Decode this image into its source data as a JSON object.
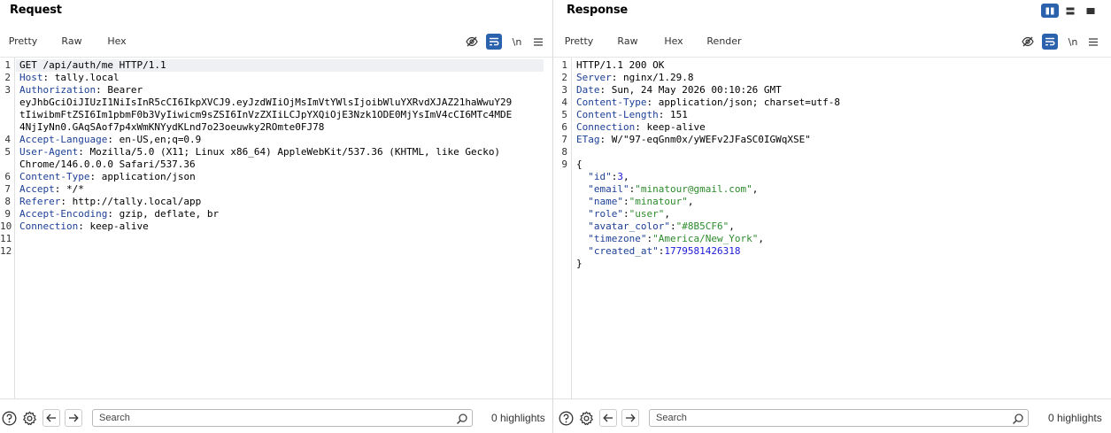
{
  "request": {
    "title": "Request",
    "tabs": [
      {
        "label": "Pretty",
        "active": true
      },
      {
        "label": "Raw",
        "active": false
      },
      {
        "label": "Hex",
        "active": false
      }
    ],
    "tools": {
      "newline_label": "\\n"
    },
    "lines": [
      {
        "n": "1",
        "parts": [
          [
            "hv",
            "GET /api/auth/me HTTP/1.1"
          ]
        ]
      },
      {
        "n": "2",
        "parts": [
          [
            "hk",
            "Host"
          ],
          [
            "hv",
            ": tally.local"
          ]
        ]
      },
      {
        "n": "3",
        "parts": [
          [
            "hk",
            "Authorization"
          ],
          [
            "hv",
            ": Bearer"
          ]
        ]
      },
      {
        "n": "",
        "parts": [
          [
            "hv",
            "eyJhbGciOiJIUzI1NiIsInR5cCI6IkpXVCJ9.eyJzdWIiOjMsImVtYWlsIjoibWluYXRvdXJAZ21haWwuY29"
          ]
        ]
      },
      {
        "n": "",
        "parts": [
          [
            "hv",
            "tIiwibmFtZSI6Im1pbmF0b3VyIiwicm9sZSI6InVzZXIiLCJpYXQiOjE3Nzk1ODE0MjYsImV4cCI6MTc4MDE"
          ]
        ]
      },
      {
        "n": "",
        "parts": [
          [
            "hv",
            "4NjIyNn0.GAqSAof7p4xWmKNYydKLnd7o23oeuwky2ROmte0FJ78"
          ]
        ]
      },
      {
        "n": "4",
        "parts": [
          [
            "hk",
            "Accept-Language"
          ],
          [
            "hv",
            ": en-US,en;q=0.9"
          ]
        ]
      },
      {
        "n": "5",
        "parts": [
          [
            "hk",
            "User-Agent"
          ],
          [
            "hv",
            ": Mozilla/5.0 (X11; Linux x86_64) AppleWebKit/537.36 (KHTML, like Gecko)"
          ]
        ]
      },
      {
        "n": "",
        "parts": [
          [
            "hv",
            "Chrome/146.0.0.0 Safari/537.36"
          ]
        ]
      },
      {
        "n": "6",
        "parts": [
          [
            "hk",
            "Content-Type"
          ],
          [
            "hv",
            ": application/json"
          ]
        ]
      },
      {
        "n": "7",
        "parts": [
          [
            "hk",
            "Accept"
          ],
          [
            "hv",
            ": */*"
          ]
        ]
      },
      {
        "n": "8",
        "parts": [
          [
            "hk",
            "Referer"
          ],
          [
            "hv",
            ": http://tally.local/app"
          ]
        ]
      },
      {
        "n": "9",
        "parts": [
          [
            "hk",
            "Accept-Encoding"
          ],
          [
            "hv",
            ": gzip, deflate, br"
          ]
        ]
      },
      {
        "n": "10",
        "parts": [
          [
            "hk",
            "Connection"
          ],
          [
            "hv",
            ": keep-alive"
          ]
        ]
      },
      {
        "n": "11",
        "parts": []
      },
      {
        "n": "12",
        "parts": []
      }
    ],
    "footer": {
      "search_placeholder": "Search",
      "highlights": "0 highlights"
    }
  },
  "response": {
    "title": "Response",
    "tabs": [
      {
        "label": "Pretty",
        "active": true
      },
      {
        "label": "Raw",
        "active": false
      },
      {
        "label": "Hex",
        "active": false
      },
      {
        "label": "Render",
        "active": false
      }
    ],
    "tools": {
      "newline_label": "\\n"
    },
    "lines": [
      {
        "n": "1",
        "parts": [
          [
            "hv",
            "HTTP/1.1 200 OK"
          ]
        ]
      },
      {
        "n": "2",
        "parts": [
          [
            "hk",
            "Server"
          ],
          [
            "hv",
            ": nginx/1.29.8"
          ]
        ]
      },
      {
        "n": "3",
        "parts": [
          [
            "hk",
            "Date"
          ],
          [
            "hv",
            ": Sun, 24 May 2026 00:10:26 GMT"
          ]
        ]
      },
      {
        "n": "4",
        "parts": [
          [
            "hk",
            "Content-Type"
          ],
          [
            "hv",
            ": application/json; charset=utf-8"
          ]
        ]
      },
      {
        "n": "5",
        "parts": [
          [
            "hk",
            "Content-Length"
          ],
          [
            "hv",
            ": 151"
          ]
        ]
      },
      {
        "n": "6",
        "parts": [
          [
            "hk",
            "Connection"
          ],
          [
            "hv",
            ": keep-alive"
          ]
        ]
      },
      {
        "n": "7",
        "parts": [
          [
            "hk",
            "ETag"
          ],
          [
            "hv",
            ": W/\"97-eqGnm0x/yWEFv2JFaSC0IGWqXSE\""
          ]
        ]
      },
      {
        "n": "8",
        "parts": []
      },
      {
        "n": "9",
        "parts": [
          [
            "jp",
            "{"
          ]
        ]
      },
      {
        "n": "",
        "parts": [
          [
            "jp",
            "  "
          ],
          [
            "jk",
            "\"id\""
          ],
          [
            "jp",
            ":"
          ],
          [
            "jn",
            "3"
          ],
          [
            "jp",
            ","
          ]
        ]
      },
      {
        "n": "",
        "parts": [
          [
            "jp",
            "  "
          ],
          [
            "jk",
            "\"email\""
          ],
          [
            "jp",
            ":"
          ],
          [
            "js",
            "\"minatour@gmail.com\""
          ],
          [
            "jp",
            ","
          ]
        ]
      },
      {
        "n": "",
        "parts": [
          [
            "jp",
            "  "
          ],
          [
            "jk",
            "\"name\""
          ],
          [
            "jp",
            ":"
          ],
          [
            "js",
            "\"minatour\""
          ],
          [
            "jp",
            ","
          ]
        ]
      },
      {
        "n": "",
        "parts": [
          [
            "jp",
            "  "
          ],
          [
            "jk",
            "\"role\""
          ],
          [
            "jp",
            ":"
          ],
          [
            "js",
            "\"user\""
          ],
          [
            "jp",
            ","
          ]
        ]
      },
      {
        "n": "",
        "parts": [
          [
            "jp",
            "  "
          ],
          [
            "jk",
            "\"avatar_color\""
          ],
          [
            "jp",
            ":"
          ],
          [
            "js",
            "\"#8B5CF6\""
          ],
          [
            "jp",
            ","
          ]
        ]
      },
      {
        "n": "",
        "parts": [
          [
            "jp",
            "  "
          ],
          [
            "jk",
            "\"timezone\""
          ],
          [
            "jp",
            ":"
          ],
          [
            "js",
            "\"America/New_York\""
          ],
          [
            "jp",
            ","
          ]
        ]
      },
      {
        "n": "",
        "parts": [
          [
            "jp",
            "  "
          ],
          [
            "jk",
            "\"created_at\""
          ],
          [
            "jp",
            ":"
          ],
          [
            "jn",
            "1779581426318"
          ]
        ]
      },
      {
        "n": "",
        "parts": [
          [
            "jp",
            "}"
          ]
        ]
      }
    ],
    "footer": {
      "search_placeholder": "Search",
      "highlights": "0 highlights"
    }
  },
  "colors": {
    "accent_tab": "#e8701a",
    "toggle_on": "#2b62ad",
    "header_key": "#1c3f96",
    "json_string": "#2c8a2c",
    "json_number": "#1a1ad8"
  }
}
